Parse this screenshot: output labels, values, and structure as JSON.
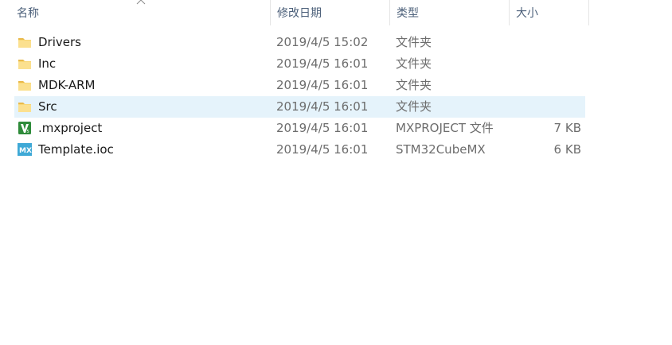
{
  "columns": {
    "name": "名称",
    "date": "修改日期",
    "type": "类型",
    "size": "大小"
  },
  "sort": {
    "column": "name",
    "direction": "ascending",
    "icon": "chevron-up-icon"
  },
  "files": [
    {
      "name": "Drivers",
      "date": "2019/4/5 15:02",
      "type": "文件夹",
      "size": "",
      "icon": "folder-icon"
    },
    {
      "name": "Inc",
      "date": "2019/4/5 16:01",
      "type": "文件夹",
      "size": "",
      "icon": "folder-icon"
    },
    {
      "name": "MDK-ARM",
      "date": "2019/4/5 16:01",
      "type": "文件夹",
      "size": "",
      "icon": "folder-icon"
    },
    {
      "name": "Src",
      "date": "2019/4/5 16:01",
      "type": "文件夹",
      "size": "",
      "icon": "folder-icon",
      "selected": true
    },
    {
      "name": ".mxproject",
      "date": "2019/4/5 16:01",
      "type": "MXPROJECT 文件",
      "size": "7 KB",
      "icon": "vim-file-icon"
    },
    {
      "name": "Template.ioc",
      "date": "2019/4/5 16:01",
      "type": "STM32CubeMX",
      "size": "6 KB",
      "icon": "stm32cubemx-icon"
    }
  ],
  "colors": {
    "selected_row": "#e5f3fb",
    "folder": "#f8d775",
    "header_text": "#4c607a",
    "mx_icon": "#3fa9d6",
    "vim_icon": "#2e8b3a"
  }
}
